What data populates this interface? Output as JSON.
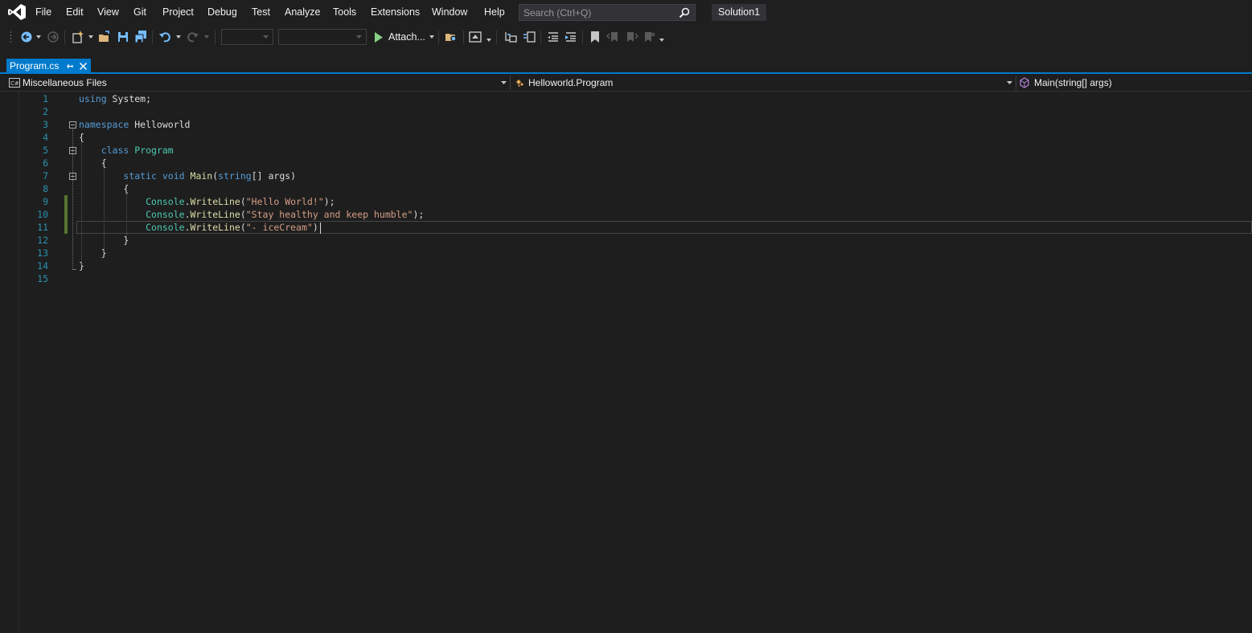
{
  "menubar": {
    "items": [
      "File",
      "Edit",
      "View",
      "Git",
      "Project",
      "Debug",
      "Test",
      "Analyze",
      "Tools",
      "Extensions",
      "Window",
      "Help"
    ],
    "search_placeholder": "Search (Ctrl+Q)",
    "solution_name": "Solution1"
  },
  "toolbar": {
    "attach_label": "Attach..."
  },
  "tabs": [
    {
      "label": "Program.cs",
      "active": true
    }
  ],
  "navbar": {
    "project": "Miscellaneous Files",
    "type": "Helloworld.Program",
    "member": "Main(string[] args)"
  },
  "editor": {
    "line_numbers": [
      "1",
      "2",
      "3",
      "4",
      "5",
      "6",
      "7",
      "8",
      "9",
      "10",
      "11",
      "12",
      "13",
      "14",
      "15"
    ],
    "lines": [
      [
        [
          "kw",
          "using"
        ],
        [
          "pl",
          " System;"
        ]
      ],
      [],
      [
        [
          "kw",
          "namespace"
        ],
        [
          "pl",
          " Helloworld"
        ]
      ],
      [
        [
          "pl",
          "{"
        ]
      ],
      [
        [
          "pl",
          "    "
        ],
        [
          "kw",
          "class"
        ],
        [
          "pl",
          " "
        ],
        [
          "ty",
          "Program"
        ]
      ],
      [
        [
          "pl",
          "    {"
        ]
      ],
      [
        [
          "pl",
          "        "
        ],
        [
          "kw",
          "static"
        ],
        [
          "pl",
          " "
        ],
        [
          "kw",
          "void"
        ],
        [
          "pl",
          " "
        ],
        [
          "fn",
          "Main"
        ],
        [
          "pl",
          "("
        ],
        [
          "kw",
          "string"
        ],
        [
          "pl",
          "[] args)"
        ]
      ],
      [
        [
          "pl",
          "        {"
        ]
      ],
      [
        [
          "pl",
          "            "
        ],
        [
          "ty",
          "Console"
        ],
        [
          "pl",
          "."
        ],
        [
          "fn",
          "WriteLine"
        ],
        [
          "pl",
          "("
        ],
        [
          "st",
          "\"Hello World!\""
        ],
        [
          "pl",
          ");"
        ]
      ],
      [
        [
          "pl",
          "            "
        ],
        [
          "ty",
          "Console"
        ],
        [
          "pl",
          "."
        ],
        [
          "fn",
          "WriteLine"
        ],
        [
          "pl",
          "("
        ],
        [
          "st",
          "\"Stay healthy and keep humble\""
        ],
        [
          "pl",
          ");"
        ]
      ],
      [
        [
          "pl",
          "            "
        ],
        [
          "ty",
          "Console"
        ],
        [
          "pl",
          "."
        ],
        [
          "fn",
          "WriteLine"
        ],
        [
          "pl",
          "("
        ],
        [
          "st",
          "\"- iceCream\""
        ],
        [
          "pl",
          ")"
        ]
      ],
      [
        [
          "pl",
          "        }"
        ]
      ],
      [
        [
          "pl",
          "    }"
        ]
      ],
      [
        [
          "pl",
          "}"
        ]
      ],
      []
    ]
  },
  "colors": {
    "accent": "#007acc",
    "background": "#1e1e1e",
    "line_number": "#2b91af",
    "keyword": "#569cd6",
    "type": "#4ec9b0",
    "method": "#dcdcaa",
    "string": "#d69d85",
    "change_marker": "#577430"
  },
  "icons": [
    "visual-studio-logo",
    "back-arrow-icon",
    "forward-arrow-icon",
    "new-project-icon",
    "open-folder-icon",
    "save-icon",
    "save-all-icon",
    "undo-icon",
    "redo-icon",
    "start-debugging-icon",
    "find-in-files-icon",
    "solution-explorer-icon",
    "csharp-file-icon",
    "class-icon",
    "method-icon",
    "bookmark-icon",
    "pin-icon",
    "close-icon"
  ]
}
